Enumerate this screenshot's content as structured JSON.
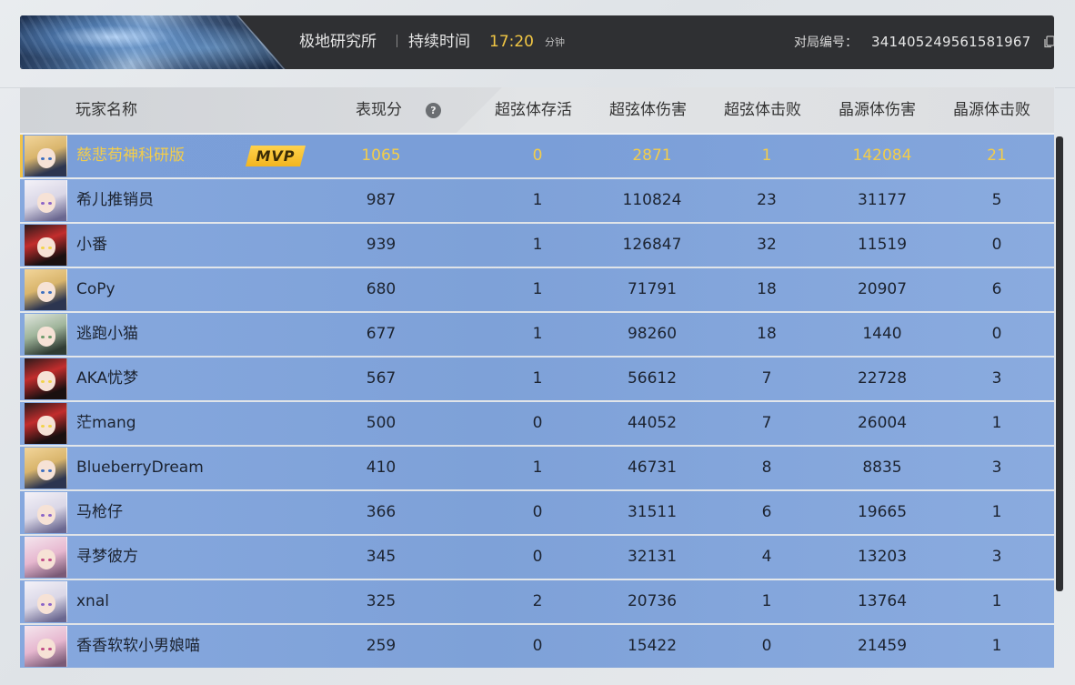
{
  "header": {
    "map_name": "极地研究所",
    "duration_label": "持续时间",
    "duration_value": "17:20",
    "duration_unit": "分钟",
    "match_label": "对局编号：",
    "match_id": "341405249561581967",
    "copy_icon": "copy-icon"
  },
  "columns": {
    "player": "玩家名称",
    "score": "表现分",
    "score_help_icon": "help-icon",
    "survive": "超弦体存活",
    "super_damage": "超弦体伤害",
    "super_kills": "超弦体击败",
    "crystal_damage": "晶源体伤害",
    "crystal_kills": "晶源体击败"
  },
  "mvp_label": "MVP",
  "colors": {
    "mvp_gold": "#f3cd4a",
    "row_blue": "#7ea1d8",
    "header_dark": "#2f3033"
  },
  "rows": [
    {
      "name": "慈悲苟神科研版",
      "score": "1065",
      "survive": "0",
      "super_damage": "2871",
      "super_kills": "1",
      "crystal_damage": "142084",
      "crystal_kills": "21",
      "mvp": true,
      "avatar": "blonde-hair"
    },
    {
      "name": "希儿推销员",
      "score": "987",
      "survive": "1",
      "super_damage": "110824",
      "super_kills": "23",
      "crystal_damage": "31177",
      "crystal_kills": "5",
      "avatar": "white-hair"
    },
    {
      "name": "小番",
      "score": "939",
      "survive": "1",
      "super_damage": "126847",
      "super_kills": "32",
      "crystal_damage": "11519",
      "crystal_kills": "0",
      "avatar": "red-mask"
    },
    {
      "name": "CoPy",
      "score": "680",
      "survive": "1",
      "super_damage": "71791",
      "super_kills": "18",
      "crystal_damage": "20907",
      "crystal_kills": "6",
      "avatar": "blonde-hair"
    },
    {
      "name": "逃跑小猫",
      "score": "677",
      "survive": "1",
      "super_damage": "98260",
      "super_kills": "18",
      "crystal_damage": "1440",
      "crystal_kills": "0",
      "avatar": "green-hair"
    },
    {
      "name": "AKA忧梦",
      "score": "567",
      "survive": "1",
      "super_damage": "56612",
      "super_kills": "7",
      "crystal_damage": "22728",
      "crystal_kills": "3",
      "avatar": "red-mask"
    },
    {
      "name": "茫mang",
      "score": "500",
      "survive": "0",
      "super_damage": "44052",
      "super_kills": "7",
      "crystal_damage": "26004",
      "crystal_kills": "1",
      "avatar": "red-mask"
    },
    {
      "name": "BlueberryDream",
      "score": "410",
      "survive": "1",
      "super_damage": "46731",
      "super_kills": "8",
      "crystal_damage": "8835",
      "crystal_kills": "3",
      "avatar": "blonde-hair"
    },
    {
      "name": "马枪仔",
      "score": "366",
      "survive": "0",
      "super_damage": "31511",
      "super_kills": "6",
      "crystal_damage": "19665",
      "crystal_kills": "1",
      "avatar": "white-hair"
    },
    {
      "name": "寻梦彼方",
      "score": "345",
      "survive": "0",
      "super_damage": "32131",
      "super_kills": "4",
      "crystal_damage": "13203",
      "crystal_kills": "3",
      "avatar": "pink-hair"
    },
    {
      "name": "xnal",
      "score": "325",
      "survive": "2",
      "super_damage": "20736",
      "super_kills": "1",
      "crystal_damage": "13764",
      "crystal_kills": "1",
      "avatar": "white-hair"
    },
    {
      "name": "香香软软小男娘喵",
      "score": "259",
      "survive": "0",
      "super_damage": "15422",
      "super_kills": "0",
      "crystal_damage": "21459",
      "crystal_kills": "1",
      "avatar": "pink-hair"
    }
  ]
}
